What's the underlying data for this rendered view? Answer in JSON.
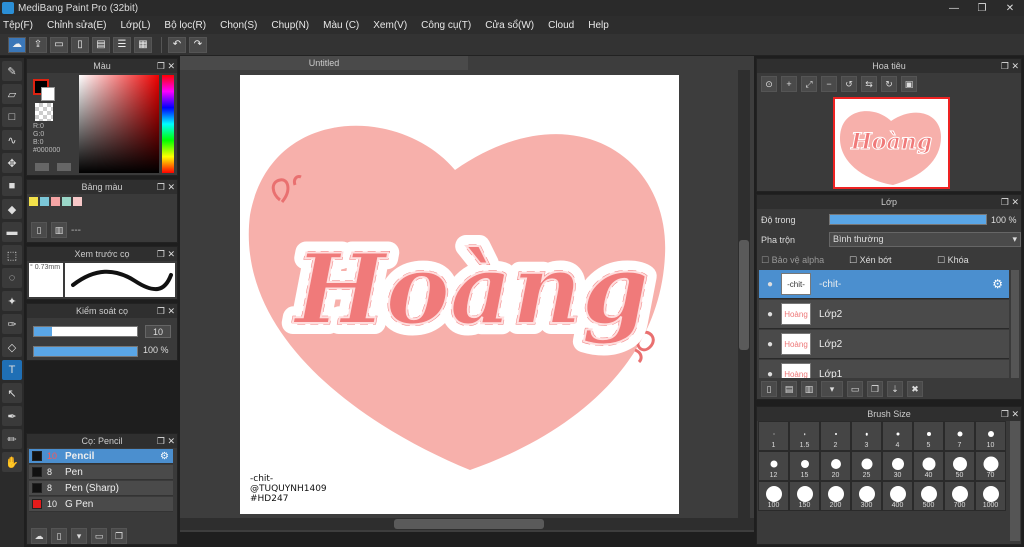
{
  "titlebar": {
    "title": "MediBang Paint Pro (32bit)",
    "min": "—",
    "max": "❐",
    "close": "✕"
  },
  "menu": [
    "Tệp(F)",
    "Chỉnh sửa(E)",
    "Lớp(L)",
    "Bộ lọc(R)",
    "Chọn(S)",
    "Chụp(N)",
    "Màu (C)",
    "Xem(V)",
    "Công cụ(T)",
    "Cửa sổ(W)",
    "Cloud",
    "Help"
  ],
  "toolbar": {
    "undo": "↶",
    "redo": "↷"
  },
  "color_panel": {
    "title": "Màu",
    "r": "R:0",
    "g": "G:0",
    "b": "B:0",
    "hex": "#000000"
  },
  "palette_panel": {
    "title": "Bảng màu",
    "extra": "---"
  },
  "preview_panel": {
    "title": "Xem trước cọ",
    "size": "° 0.73mm"
  },
  "control_panel": {
    "title": "Kiểm soát cọ",
    "size_value": "10",
    "opacity_value": "100 %"
  },
  "brush_panel": {
    "title": "Cọ: Pencil",
    "items": [
      {
        "size": "10",
        "name": "Pencil",
        "color": "#111111"
      },
      {
        "size": "8",
        "name": "Pen",
        "color": "#111111"
      },
      {
        "size": "8",
        "name": "Pen (Sharp)",
        "color": "#111111"
      },
      {
        "size": "10",
        "name": "G Pen",
        "color": "#e31b1b"
      }
    ]
  },
  "document": {
    "tab": "Untitled"
  },
  "artwork": {
    "main_text": "Hoàng",
    "credit_1": "-chit-",
    "credit_2": "@TUQUYNH1409",
    "credit_3": "#HD247"
  },
  "navigator": {
    "title": "Hoa tiêu",
    "thumb_text": "Hoàng"
  },
  "layer_panel": {
    "title": "Lớp",
    "opacity_label": "Độ trong",
    "opacity_value": "100 %",
    "blend_label": "Pha trộn",
    "blend_value": "Bình thường",
    "protect_alpha": "Bảo vệ alpha",
    "clipping": "Xén bớt",
    "lock": "Khóa",
    "layers": [
      {
        "name": "-chit-",
        "thumb": "-chit-"
      },
      {
        "name": "Lớp2",
        "thumb": "Hoàng"
      },
      {
        "name": "Lớp2",
        "thumb": "Hoàng"
      },
      {
        "name": "Lớp1",
        "thumb": "Hoàng"
      }
    ]
  },
  "brush_size_panel": {
    "title": "Brush Size",
    "sizes": [
      {
        "label": "1",
        "d": 1
      },
      {
        "label": "1.5",
        "d": 1.5
      },
      {
        "label": "2",
        "d": 2
      },
      {
        "label": "3",
        "d": 2.5
      },
      {
        "label": "4",
        "d": 3
      },
      {
        "label": "5",
        "d": 4
      },
      {
        "label": "7",
        "d": 5
      },
      {
        "label": "10",
        "d": 6
      },
      {
        "label": "12",
        "d": 7
      },
      {
        "label": "15",
        "d": 8
      },
      {
        "label": "20",
        "d": 10
      },
      {
        "label": "25",
        "d": 11
      },
      {
        "label": "30",
        "d": 12
      },
      {
        "label": "40",
        "d": 13
      },
      {
        "label": "50",
        "d": 14
      },
      {
        "label": "70",
        "d": 15
      },
      {
        "label": "100",
        "d": 16
      },
      {
        "label": "150",
        "d": 16
      },
      {
        "label": "200",
        "d": 16
      },
      {
        "label": "300",
        "d": 16
      },
      {
        "label": "400",
        "d": 16
      },
      {
        "label": "500",
        "d": 16
      },
      {
        "label": "700",
        "d": 16
      },
      {
        "label": "1000",
        "d": 16
      }
    ]
  },
  "colors": {
    "accent": "#4b8fcf",
    "heart": "#f7b0ab",
    "text_pink": "#f07a7a"
  }
}
